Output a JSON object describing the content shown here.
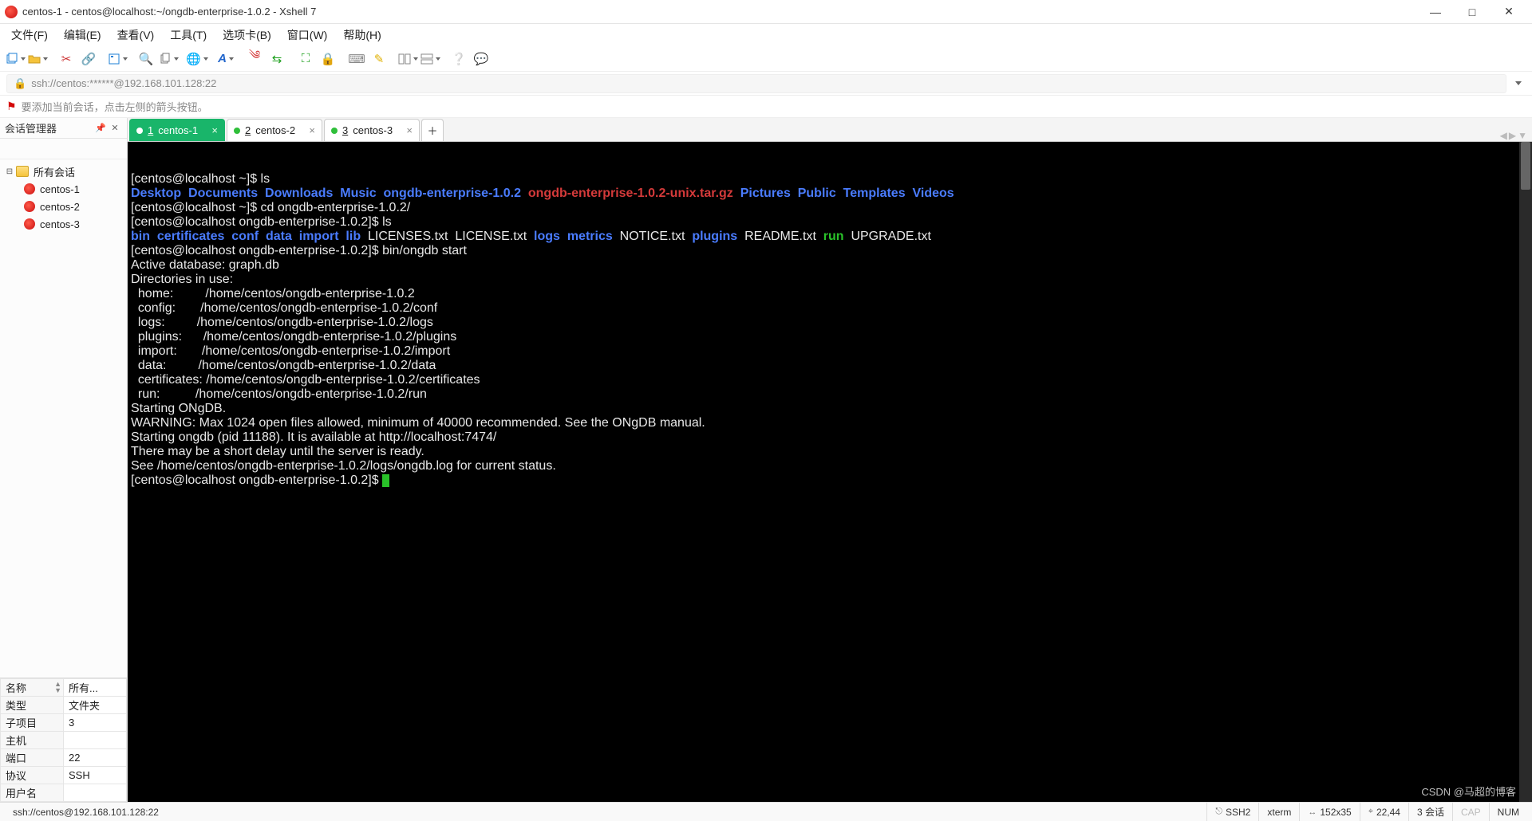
{
  "titlebar": {
    "title": "centos-1 - centos@localhost:~/ongdb-enterprise-1.0.2 - Xshell 7"
  },
  "menus": {
    "file": "文件(F)",
    "edit": "编辑(E)",
    "view": "查看(V)",
    "tools": "工具(T)",
    "tab": "选项卡(B)",
    "window": "窗口(W)",
    "help": "帮助(H)"
  },
  "address": {
    "url": "ssh://centos:******@192.168.101.128:22"
  },
  "hint": {
    "text": "要添加当前会话，点击左侧的箭头按钮。"
  },
  "sessionPanel": {
    "title": "会话管理器",
    "rootLabel": "所有会话",
    "items": [
      {
        "label": "centos-1"
      },
      {
        "label": "centos-2"
      },
      {
        "label": "centos-3"
      }
    ],
    "props": [
      {
        "k": "名称",
        "v": "所有..."
      },
      {
        "k": "类型",
        "v": "文件夹"
      },
      {
        "k": "子项目",
        "v": "3"
      },
      {
        "k": "主机",
        "v": ""
      },
      {
        "k": "端口",
        "v": "22"
      },
      {
        "k": "协议",
        "v": "SSH"
      },
      {
        "k": "用户名",
        "v": ""
      }
    ]
  },
  "tabs": [
    {
      "num": "1",
      "label": "centos-1",
      "active": true
    },
    {
      "num": "2",
      "label": "centos-2",
      "active": false
    },
    {
      "num": "3",
      "label": "centos-3",
      "active": false
    }
  ],
  "terminal": {
    "lines": [
      [
        {
          "c": "t-white",
          "t": "[centos@localhost ~]$ ls"
        }
      ],
      [
        {
          "c": "t-blue",
          "t": "Desktop"
        },
        {
          "c": "t-white",
          "t": "  "
        },
        {
          "c": "t-blue",
          "t": "Documents"
        },
        {
          "c": "t-white",
          "t": "  "
        },
        {
          "c": "t-blue",
          "t": "Downloads"
        },
        {
          "c": "t-white",
          "t": "  "
        },
        {
          "c": "t-blue",
          "t": "Music"
        },
        {
          "c": "t-white",
          "t": "  "
        },
        {
          "c": "t-blue",
          "t": "ongdb-enterprise-1.0.2"
        },
        {
          "c": "t-white",
          "t": "  "
        },
        {
          "c": "t-red",
          "t": "ongdb-enterprise-1.0.2-unix.tar.gz"
        },
        {
          "c": "t-white",
          "t": "  "
        },
        {
          "c": "t-blue",
          "t": "Pictures"
        },
        {
          "c": "t-white",
          "t": "  "
        },
        {
          "c": "t-blue",
          "t": "Public"
        },
        {
          "c": "t-white",
          "t": "  "
        },
        {
          "c": "t-blue",
          "t": "Templates"
        },
        {
          "c": "t-white",
          "t": "  "
        },
        {
          "c": "t-blue",
          "t": "Videos"
        }
      ],
      [
        {
          "c": "t-white",
          "t": "[centos@localhost ~]$ cd ongdb-enterprise-1.0.2/"
        }
      ],
      [
        {
          "c": "t-white",
          "t": "[centos@localhost ongdb-enterprise-1.0.2]$ ls"
        }
      ],
      [
        {
          "c": "t-blue",
          "t": "bin"
        },
        {
          "c": "t-white",
          "t": "  "
        },
        {
          "c": "t-blue",
          "t": "certificates"
        },
        {
          "c": "t-white",
          "t": "  "
        },
        {
          "c": "t-blue",
          "t": "conf"
        },
        {
          "c": "t-white",
          "t": "  "
        },
        {
          "c": "t-blue",
          "t": "data"
        },
        {
          "c": "t-white",
          "t": "  "
        },
        {
          "c": "t-blue",
          "t": "import"
        },
        {
          "c": "t-white",
          "t": "  "
        },
        {
          "c": "t-blue",
          "t": "lib"
        },
        {
          "c": "t-white",
          "t": "  LICENSES.txt  LICENSE.txt  "
        },
        {
          "c": "t-blue",
          "t": "logs"
        },
        {
          "c": "t-white",
          "t": "  "
        },
        {
          "c": "t-blue",
          "t": "metrics"
        },
        {
          "c": "t-white",
          "t": "  NOTICE.txt  "
        },
        {
          "c": "t-blue",
          "t": "plugins"
        },
        {
          "c": "t-white",
          "t": "  README.txt  "
        },
        {
          "c": "t-green",
          "t": "run"
        },
        {
          "c": "t-white",
          "t": "  UPGRADE.txt"
        }
      ],
      [
        {
          "c": "t-white",
          "t": "[centos@localhost ongdb-enterprise-1.0.2]$ bin/ongdb start"
        }
      ],
      [
        {
          "c": "t-white",
          "t": "Active database: graph.db"
        }
      ],
      [
        {
          "c": "t-white",
          "t": "Directories in use:"
        }
      ],
      [
        {
          "c": "t-white",
          "t": "  home:         /home/centos/ongdb-enterprise-1.0.2"
        }
      ],
      [
        {
          "c": "t-white",
          "t": "  config:       /home/centos/ongdb-enterprise-1.0.2/conf"
        }
      ],
      [
        {
          "c": "t-white",
          "t": "  logs:         /home/centos/ongdb-enterprise-1.0.2/logs"
        }
      ],
      [
        {
          "c": "t-white",
          "t": "  plugins:      /home/centos/ongdb-enterprise-1.0.2/plugins"
        }
      ],
      [
        {
          "c": "t-white",
          "t": "  import:       /home/centos/ongdb-enterprise-1.0.2/import"
        }
      ],
      [
        {
          "c": "t-white",
          "t": "  data:         /home/centos/ongdb-enterprise-1.0.2/data"
        }
      ],
      [
        {
          "c": "t-white",
          "t": "  certificates: /home/centos/ongdb-enterprise-1.0.2/certificates"
        }
      ],
      [
        {
          "c": "t-white",
          "t": "  run:          /home/centos/ongdb-enterprise-1.0.2/run"
        }
      ],
      [
        {
          "c": "t-white",
          "t": "Starting ONgDB."
        }
      ],
      [
        {
          "c": "t-white",
          "t": "WARNING: Max 1024 open files allowed, minimum of 40000 recommended. See the ONgDB manual."
        }
      ],
      [
        {
          "c": "t-white",
          "t": "Starting ongdb (pid 11188). It is available at http://localhost:7474/"
        }
      ],
      [
        {
          "c": "t-white",
          "t": "There may be a short delay until the server is ready."
        }
      ],
      [
        {
          "c": "t-white",
          "t": "See /home/centos/ongdb-enterprise-1.0.2/logs/ongdb.log for current status."
        }
      ],
      [
        {
          "c": "t-white",
          "t": "[centos@localhost ongdb-enterprise-1.0.2]$ "
        },
        {
          "c": "cursor",
          "t": ""
        }
      ]
    ]
  },
  "statusbar": {
    "left": "ssh://centos@192.168.101.128:22",
    "ssh": "SSH2",
    "term": "xterm",
    "size": "152x35",
    "pos": "22,44",
    "sess": "3 会话",
    "cap": "CAP",
    "num": "NUM"
  },
  "watermark": "CSDN @马超的博客"
}
